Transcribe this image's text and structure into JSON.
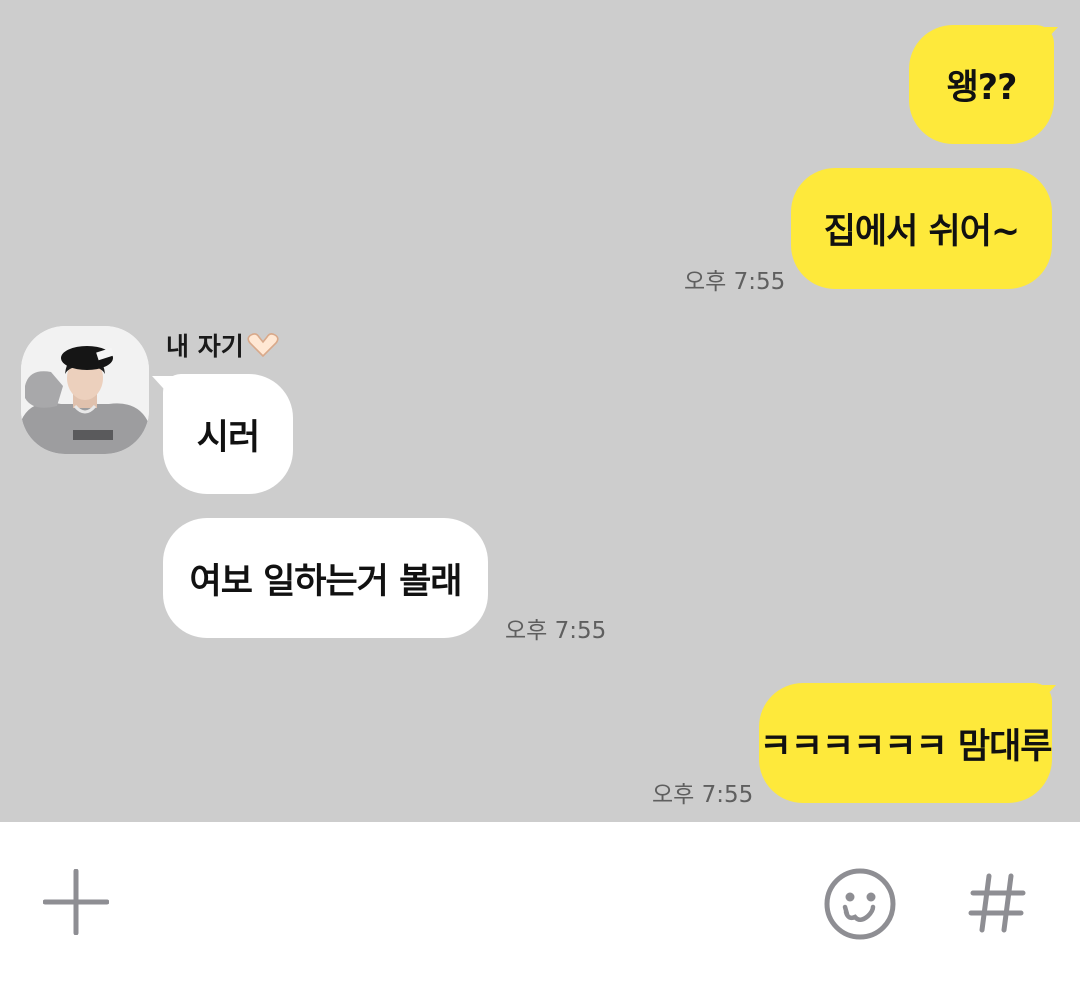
{
  "colors": {
    "chat_background": "#cdcdcd",
    "my_bubble": "#fee93b",
    "their_bubble": "#ffffff",
    "input_bar": "#ffffff",
    "timestamp_text": "#5f5f5f",
    "icon_gray": "#8e8e93"
  },
  "chat": {
    "partner_name": "내 자기",
    "partner_name_emoji": "heart-hands-icon",
    "messages": [
      {
        "from": "me",
        "text": "왱??"
      },
      {
        "from": "me",
        "text": "집에서 쉬어~",
        "time": "오후 7:55"
      },
      {
        "from": "partner",
        "text": "시러"
      },
      {
        "from": "partner",
        "text": "여보 일하는거 볼래",
        "time": "오후 7:55"
      },
      {
        "from": "me",
        "text": "ㅋㅋㅋㅋㅋㅋ 맘대루",
        "time": "오후 7:55"
      }
    ]
  },
  "input_bar": {
    "icons": [
      "plus-icon",
      "emoticon-icon",
      "hashtag-icon"
    ]
  }
}
